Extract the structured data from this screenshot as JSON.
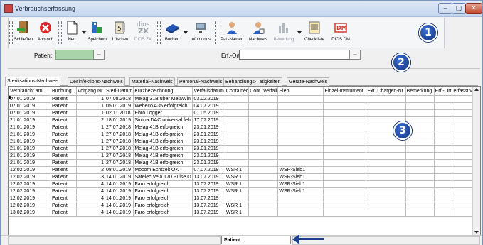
{
  "window": {
    "title": "Verbrauchserfassung",
    "controls": [
      "–",
      "▢",
      "✕"
    ]
  },
  "toolbar": {
    "buttons": [
      {
        "label": "Schließen",
        "icon": "exit-door-icon",
        "enabled": true
      },
      {
        "label": "Abbruch",
        "icon": "cancel-icon",
        "enabled": true
      },
      {
        "label": "Neu",
        "icon": "new-document-icon",
        "enabled": true
      },
      {
        "label": "Speichern",
        "icon": "save-icon",
        "enabled": true
      },
      {
        "label": "Löschen",
        "icon": "delete-icon",
        "enabled": true
      },
      {
        "label": "DIOS ZX",
        "icon": "dios-zx-icon",
        "enabled": false
      },
      {
        "label": "Buchen",
        "icon": "book-icon",
        "enabled": true
      },
      {
        "label": "Infomodus",
        "icon": "info-monitor-icon",
        "enabled": true
      },
      {
        "label": "Pat.-Namen",
        "icon": "person-icon",
        "enabled": true
      },
      {
        "label": "Nachweis",
        "icon": "person-proof-icon",
        "enabled": true
      },
      {
        "label": "Bewertung",
        "icon": "chart-icon",
        "enabled": false
      },
      {
        "label": "Checkliste",
        "icon": "checklist-icon",
        "enabled": true
      },
      {
        "label": "DIOS DM",
        "icon": "dios-dm-icon",
        "enabled": true
      }
    ],
    "dios_zx_text": "dios\nZX",
    "dios_dm_text": "DM"
  },
  "badges": {
    "one": "1",
    "two": "2",
    "three": "3"
  },
  "fields": {
    "patient_label": "Patient",
    "patient_button": "...",
    "erf_ort_label": "Erf.-Ort",
    "erf_ort_button": "..."
  },
  "tabs": [
    "Sterilisations-Nachweis",
    "Desinfektions-Nachweis",
    "Material-Nachweis",
    "Personal-Nachweis",
    "Behandlungs-Tätigkeiten",
    "Geräte-Nachweis"
  ],
  "grid": {
    "columns": [
      "Verbraucht am",
      "Buchung",
      "Vorgang Nr.",
      "Steri-Datum",
      "Kurzbezeichnung",
      "Verfallsdatum",
      "Container",
      "Cont. Verfall",
      "Sieb",
      "Einzel-Instrument",
      "Ext. Chargen-Nr.",
      "Bemerkung",
      "Erf.-Ort",
      "erfasst von"
    ],
    "rows": [
      [
        "07.01.2019",
        "Patient",
        "1",
        "07.08.2018",
        "Melag 31B über MelaWin",
        "03.02.2019",
        "",
        "",
        "",
        "",
        "",
        "",
        "",
        ""
      ],
      [
        "07.01.2019",
        "Patient",
        "1",
        "05.01.2019",
        "Webeco A35 erfolgreich",
        "04.07.2019",
        "",
        "",
        "",
        "",
        "",
        "",
        "",
        ""
      ],
      [
        "07.01.2019",
        "Patient",
        "1",
        "02.11.2018",
        "Ebro Logger",
        "01.05.2019",
        "",
        "",
        "",
        "",
        "",
        "",
        "",
        ""
      ],
      [
        "21.01.2019",
        "Patient",
        "2",
        "18.01.2019",
        "Sirona DAC universal fehl",
        "17.07.2019",
        "",
        "",
        "",
        "",
        "",
        "",
        "",
        ""
      ],
      [
        "21.01.2019",
        "Patient",
        "1",
        "27.07.2018",
        "Melag 41B erfolgreich",
        "23.01.2019",
        "",
        "",
        "",
        "",
        "",
        "",
        "",
        ""
      ],
      [
        "21.01.2019",
        "Patient",
        "1",
        "27.07.2018",
        "Melag 41B erfolgreich",
        "23.01.2019",
        "",
        "",
        "",
        "",
        "",
        "",
        "",
        ""
      ],
      [
        "21.01.2019",
        "Patient",
        "1",
        "27.07.2018",
        "Melag 41B erfolgreich",
        "23.01.2019",
        "",
        "",
        "",
        "",
        "",
        "",
        "",
        ""
      ],
      [
        "21.01.2019",
        "Patient",
        "1",
        "27.07.2018",
        "Melag 41B erfolgreich",
        "23.01.2019",
        "",
        "",
        "",
        "",
        "",
        "",
        "",
        ""
      ],
      [
        "21.01.2019",
        "Patient",
        "1",
        "27.07.2018",
        "Melag 41B erfolgreich",
        "23.01.2019",
        "",
        "",
        "",
        "",
        "",
        "",
        "",
        ""
      ],
      [
        "21.01.2019",
        "Patient",
        "1",
        "27.07.2018",
        "Melag 41B erfolgreich",
        "23.01.2019",
        "",
        "",
        "",
        "",
        "",
        "",
        "",
        ""
      ],
      [
        "12.02.2019",
        "Patient",
        "2",
        "08.01.2019",
        "Mocom Echtzeit OK",
        "07.07.2019",
        "WSR 1",
        "",
        "WSR-Sieb1",
        "",
        "",
        "",
        "",
        ""
      ],
      [
        "12.02.2019",
        "Patient",
        "3",
        "14.01.2019",
        "Satelec Vela 170 Pulse O",
        "13.07.2019",
        "WSR 1",
        "",
        "WSR-Sieb1",
        "",
        "",
        "",
        "",
        ""
      ],
      [
        "12.02.2019",
        "Patient",
        "4",
        "14.01.2019",
        "Faro erfolgreich",
        "13.07.2019",
        "WSR 1",
        "",
        "WSR-Sieb1",
        "",
        "",
        "",
        "",
        ""
      ],
      [
        "12.02.2019",
        "Patient",
        "4",
        "14.01.2019",
        "Faro erfolgreich",
        "13.07.2019",
        "WSR 1",
        "",
        "WSR-Sieb1",
        "",
        "",
        "",
        "",
        ""
      ],
      [
        "12.02.2019",
        "Patient",
        "4",
        "14.01.2019",
        "Faro erfolgreich",
        "13.07.2019",
        "",
        "",
        "",
        "",
        "",
        "",
        "",
        ""
      ],
      [
        "12.02.2019",
        "Patient",
        "4",
        "14.01.2019",
        "Faro erfolgreich",
        "13.07.2019",
        "WSR 1",
        "",
        "",
        "",
        "",
        "",
        "",
        ""
      ],
      [
        "13.02.2019",
        "Patient",
        "4",
        "14.01.2019",
        "Faro erfolgreich",
        "13.07.2019",
        "WSR 1",
        "",
        "",
        "",
        "",
        "",
        "",
        ""
      ]
    ]
  },
  "statusbar": {
    "mode": "Patient"
  },
  "colors": {
    "badge": "#1d3f8f",
    "patient_field": "#a9d3a9",
    "arrow": "#1d3f8f"
  }
}
